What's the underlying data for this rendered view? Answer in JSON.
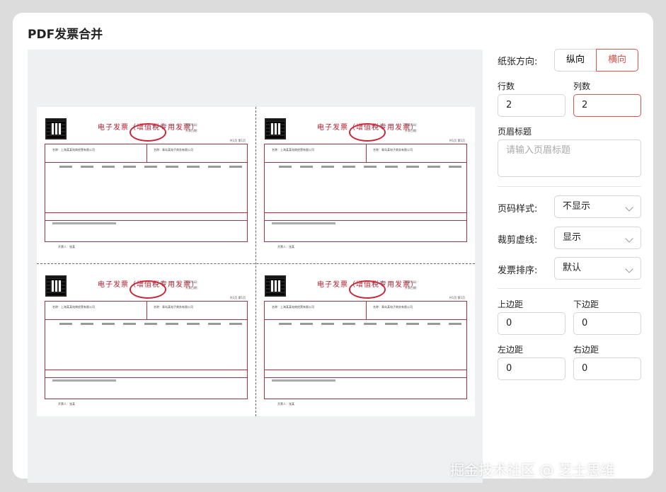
{
  "page_title": "PDF发票合并",
  "invoice": {
    "title": "电子发票（增值税专用发票）",
    "meta_no": "发票号码：",
    "meta_date": "开票日期：",
    "page": "共1页 第1页",
    "buyer": "名称：上海某某电商经营有限公司",
    "seller": "名称：青岛某电子商务有限公司",
    "signer": "开票人：张某"
  },
  "settings": {
    "orientation": {
      "label": "纸张方向:",
      "options": [
        "纵向",
        "横向"
      ],
      "selected": "横向"
    },
    "rows": {
      "label": "行数",
      "value": "2"
    },
    "cols": {
      "label": "列数",
      "value": "2"
    },
    "header": {
      "label": "页眉标题",
      "placeholder": "请输入页眉标题"
    },
    "page_number": {
      "label": "页码样式:",
      "value": "不显示"
    },
    "cut_line": {
      "label": "裁剪虚线:",
      "value": "显示"
    },
    "sort": {
      "label": "发票排序:",
      "value": "默认"
    },
    "margins": {
      "top": {
        "label": "上边距",
        "value": "0"
      },
      "bottom": {
        "label": "下边距",
        "value": "0"
      },
      "left": {
        "label": "左边距",
        "value": "0"
      },
      "right": {
        "label": "右边距",
        "value": "0"
      }
    }
  },
  "watermark": "掘金技术社区 @ 芝士思维",
  "colors": {
    "accent": "#d9534f",
    "invoice_red": "#b0303d"
  }
}
